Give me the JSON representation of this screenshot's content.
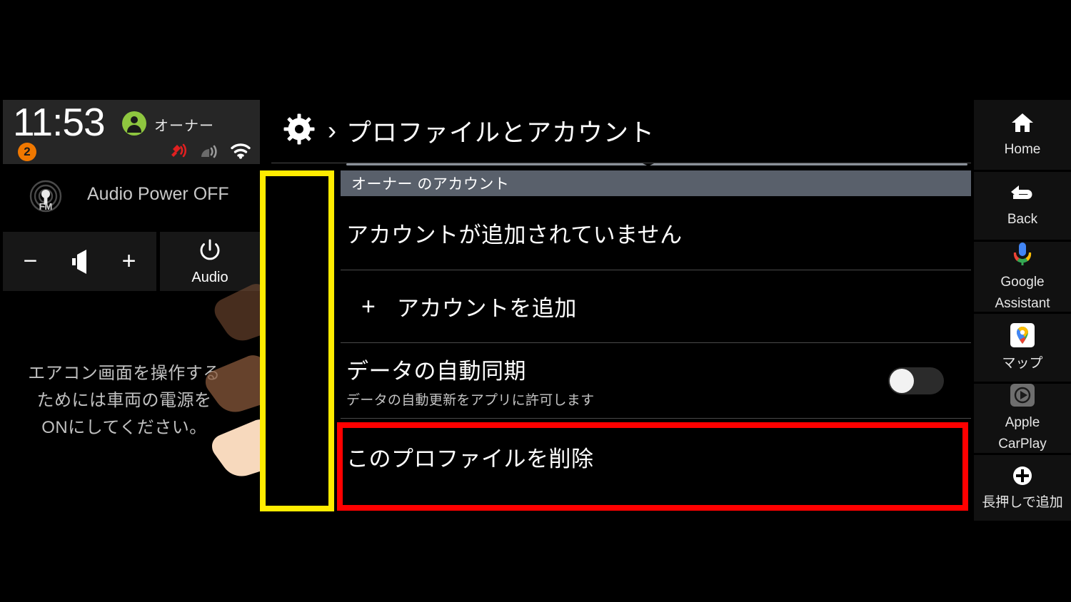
{
  "status_bar": {
    "time": "11:53",
    "profile_name": "オーナー",
    "notification_count": "2",
    "icons": [
      "gps-muted-icon",
      "cellular-signal-icon",
      "wifi-icon"
    ]
  },
  "audio_panel": {
    "source_icon": "fm-radio-icon",
    "power_status": "Audio Power OFF",
    "volume_minus": "−",
    "volume_icon": "speaker-icon",
    "volume_plus": "+",
    "audio_power_label": "Audio",
    "hvac_message": "エアコン画面を操作する\nためには車両の電源を\nONにしてください。"
  },
  "scrollbar": {
    "up_label": "scroll-up",
    "down_label": "scroll-down",
    "thumb_position_pct": 30
  },
  "header": {
    "gear_icon": "settings-gear-icon",
    "separator": "›",
    "title": "プロファイルとアカウント"
  },
  "content": {
    "section_header": "オーナー のアカウント",
    "rows": [
      {
        "title": "アカウントが追加されていません",
        "sub": ""
      },
      {
        "prefix": "+",
        "title": "アカウントを追加",
        "sub": ""
      },
      {
        "title": "データの自動同期",
        "sub": "データの自動更新をアプリに許可します",
        "toggle": "off"
      },
      {
        "title": "このプロファイルを削除",
        "sub": ""
      }
    ]
  },
  "sidebar": {
    "items": [
      {
        "label": "Home",
        "icon": "home-icon"
      },
      {
        "label": "Back",
        "icon": "back-arrow-icon"
      },
      {
        "label": "Google\nAssistant",
        "label_line1": "Google",
        "label_line2": "Assistant",
        "icon": "google-assistant-mic-icon"
      },
      {
        "label": "マップ",
        "icon": "google-maps-icon"
      },
      {
        "label": "Apple\nCarPlay",
        "label_line1": "Apple",
        "label_line2": "CarPlay",
        "icon": "apple-carplay-icon"
      },
      {
        "label": "長押しで追加",
        "icon": "plus-circle-icon"
      }
    ]
  },
  "annotations": {
    "yellow_highlight": "#ffec00",
    "red_highlight": "#ff0000",
    "gesture": "swipe-down-hand-animation"
  },
  "colors": {
    "accent_green": "#8ec63f",
    "badge_orange": "#f07800",
    "section_header_gray": "#59606b",
    "background": "#000000"
  }
}
